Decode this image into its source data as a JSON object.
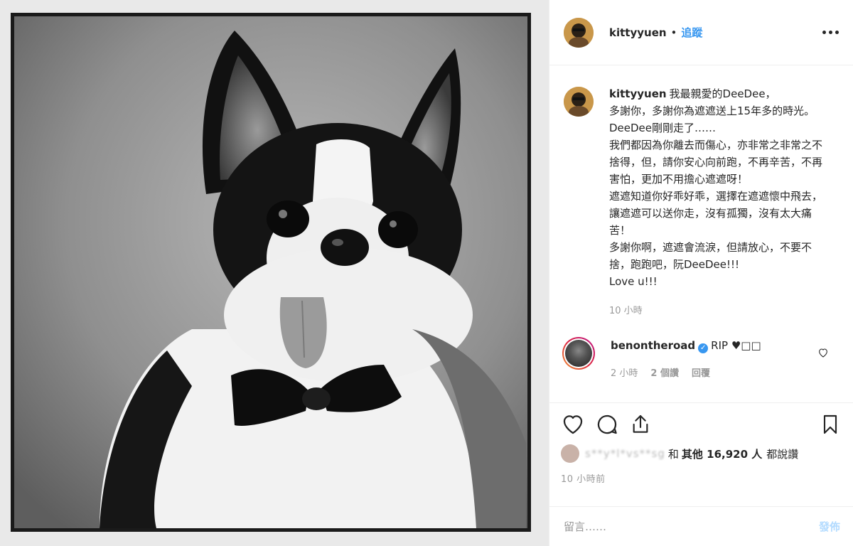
{
  "header": {
    "username": "kittyyuen",
    "dot": "•",
    "follow_label": "追蹤"
  },
  "caption": {
    "username": "kittyyuen",
    "text": "我最親愛的DeeDee，\n多謝你，多謝你為遮遮送上15年多的時光。DeeDee剛剛走了……\n我們都因為你離去而傷心，亦非常之非常之不捨得，但，請你安心向前跑，不再辛苦，不再害怕，更加不用擔心遮遮呀！\n遮遮知道你好乖好乖，選擇在遮遮懷中飛去，讓遮遮可以送你走，沒有孤獨，沒有太大痛苦！\n多謝你啊，遮遮會流淚，但請放心，不要不捨，跑跑吧，阮DeeDee!!!\nLove u!!!",
    "time": "10 小時"
  },
  "comment": {
    "username": "benontheroad",
    "verified_mark": "✓",
    "text": "RIP ♥︎□□",
    "time": "2 小時",
    "likes": "2 個讚",
    "reply_label": "回覆"
  },
  "likes": {
    "blurred_names": "s**y*l*vs**sg",
    "connector": "和",
    "others_label": "其他 16,920 人",
    "suffix": "都說讚"
  },
  "post_time": "10 小時前",
  "add_comment": {
    "placeholder": "留言……",
    "post_label": "發佈"
  },
  "colors": {
    "accent": "#3897f0",
    "post_disabled": "#b3dbff",
    "muted": "#999999",
    "text": "#262626"
  },
  "icons": [
    "heart-icon",
    "comment-icon",
    "share-icon",
    "bookmark-icon",
    "more-icon",
    "verified-icon"
  ]
}
